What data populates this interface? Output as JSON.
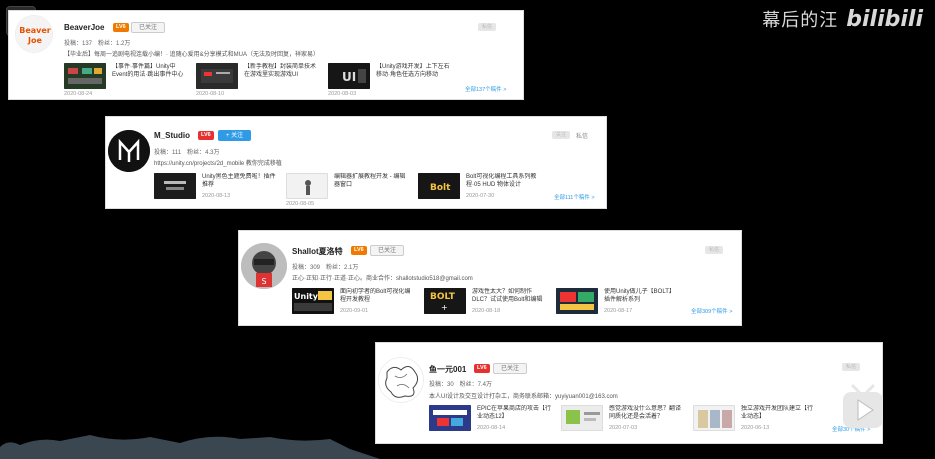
{
  "watermark": {
    "text": "幕后的汪",
    "logo": "bilibili"
  },
  "top_left": {
    "plus": "+"
  },
  "cards": [
    {
      "name": "BeaverJoe",
      "level": "LV6",
      "follow": "已关注",
      "top_badge": "私信",
      "stats": "投稿：137　粉丝：1.2万",
      "sign": "【毕业后】每周一追剧电视连载小编！· 追随心爱用&分享模式和MUA（无法及时回复，祥家易）",
      "avatar_text": "Beaver\nJoe",
      "videos": [
        {
          "title": "【事件·事件篇】Unity中Event的用法·跳出事件中心",
          "date": "2020-08-24"
        },
        {
          "title": "【新手教程】封装简单技术在游戏里实现游戏UI",
          "date": "2020-08-10"
        },
        {
          "title": "【Unity游戏开发】上下左右移动·角色任选方向移动",
          "date": "2020-08-03"
        }
      ],
      "more": "全部137个稿件 >"
    },
    {
      "name": "M_Studio",
      "level": "LV6",
      "follow": "+ 关注",
      "top_badge": "关注",
      "msg": "私信",
      "stats": "投稿：111　粉丝：4.3万",
      "sign": "https://unity.cn/projects/2d_mobile 教你完成移植",
      "videos": [
        {
          "title": "Unity黑色主题免费啦！插件推荐",
          "date": "2020-08-13"
        },
        {
          "title": "编辑器扩展教程开发 - 编辑器窗口",
          "date": "2020-08-05"
        },
        {
          "title": "Bolt可视化编程工具系列教程·05 HUD 物体设计",
          "date": "2020-07-30"
        }
      ],
      "more": "全部111个稿件 >"
    },
    {
      "name": "Shallot夏洛特",
      "level": "LV6",
      "follow": "已关注",
      "top_badge": "私信",
      "stats": "投稿：309　粉丝：2.1万",
      "sign": "正心·正知·正行·正道·正心。商业合作：shallotstudio518@gmail.com",
      "videos": [
        {
          "title": "面向初学者的Bolt可视化编程开发教程",
          "date": "2020-09-01"
        },
        {
          "title": "游戏性太大？如何制作DLC？试试使用Bolt和编辑器",
          "date": "2020-08-18"
        },
        {
          "title": "使用Unity做儿子【BOLT】插件解析系列",
          "date": "2020-08-17"
        }
      ],
      "more": "全部309个稿件 >"
    },
    {
      "name": "鱼一元001",
      "level": "LV6",
      "follow": "已关注",
      "top_badge": "私信",
      "stats": "投稿：30　粉丝：7.4万",
      "sign": "本人UI设计及交互设计打杂工，商务联系邮箱：yuyiyuan001@163.com",
      "videos": [
        {
          "title": "EPIC在苹果商店的攻击【行业动态12】",
          "date": "2020-08-14"
        },
        {
          "title": "感觉游戏没什么意思？翻译同质化还是会活着？",
          "date": "2020-07-03"
        },
        {
          "title": "独立游戏开发团队建立【行业动态】",
          "date": "2020-06-13"
        }
      ],
      "more": "全部30个稿件 >"
    }
  ],
  "colors": {
    "accent_blue": "#2f9be6",
    "level_orange": "#f07a00",
    "level_red": "#e5312f",
    "background": "#000000"
  }
}
